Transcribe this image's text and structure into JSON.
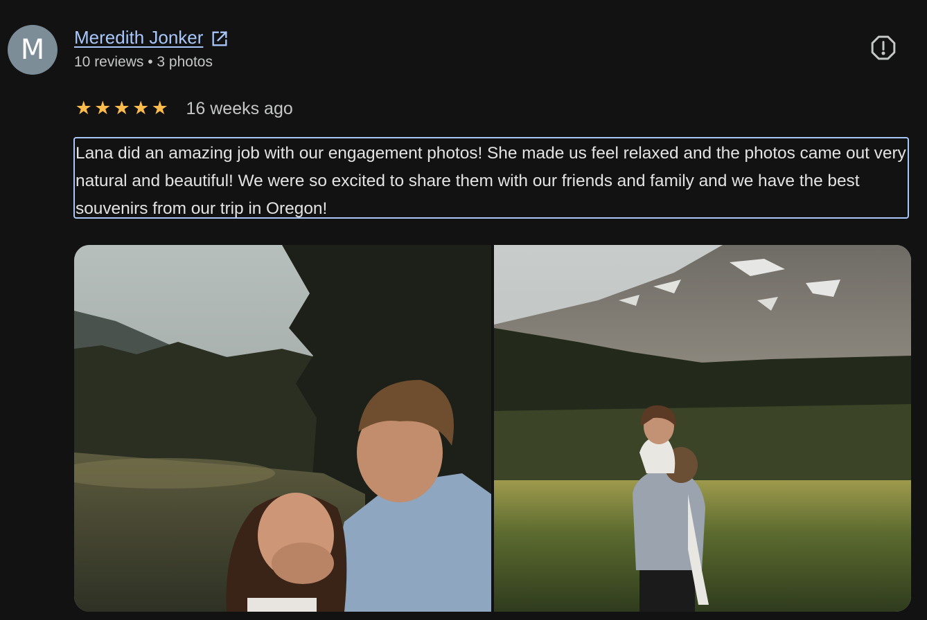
{
  "author": {
    "initial": "M",
    "name": "Meredith Jonker",
    "meta": "10 reviews • 3 photos",
    "avatar_color": "#7c8d97"
  },
  "review": {
    "rating": 5,
    "max_rating": 5,
    "stars": [
      "★",
      "★",
      "★",
      "★",
      "★"
    ],
    "time_ago": "16 weeks ago",
    "text": "Lana did an amazing job with our engagement photos! She made us feel relaxed and the photos came out very natural and beautiful! We were so excited to share them with our friends and family and we have the best souvenirs from our trip in Oregon!"
  },
  "icons": {
    "external": "external-link-icon",
    "report": "report-icon"
  },
  "colors": {
    "background": "#121212",
    "link": "#a8c7fa",
    "star": "#fdbc4b",
    "text": "#e3e3e3",
    "muted": "#c4c7c5"
  }
}
